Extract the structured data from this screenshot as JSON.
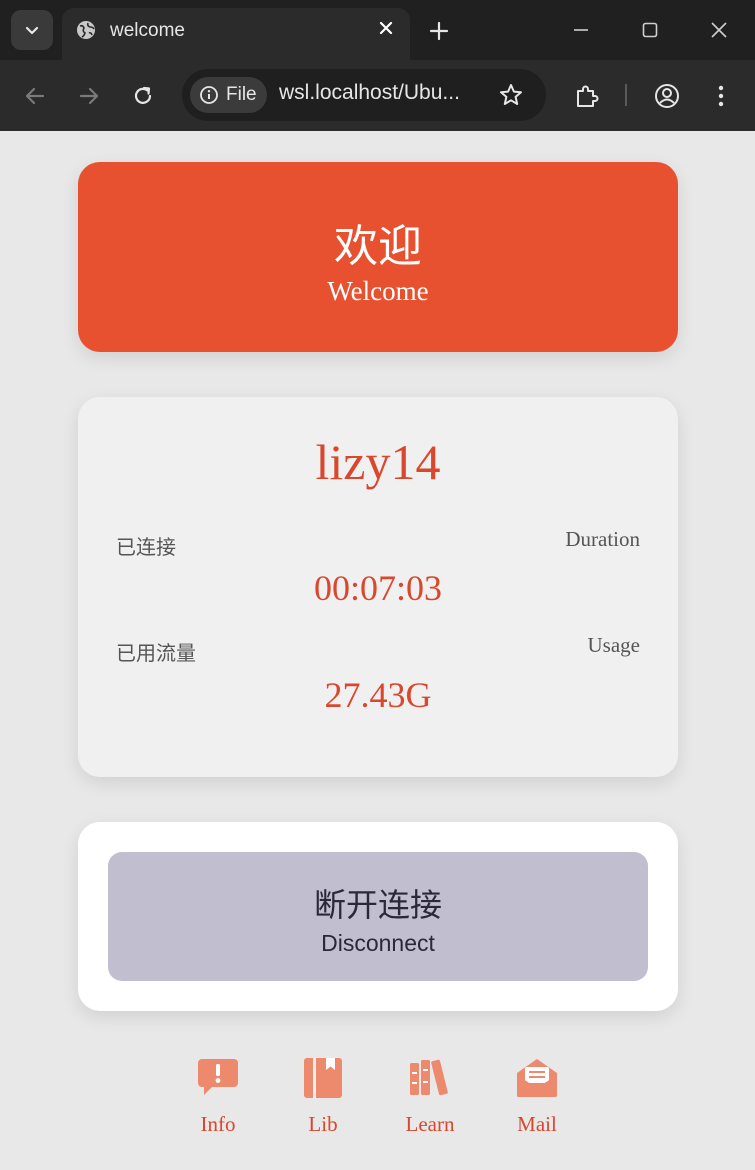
{
  "browser": {
    "tab_title": "welcome",
    "site_chip_label": "File",
    "url": "wsl.localhost/Ubu..."
  },
  "colors": {
    "accent": "#e8512f",
    "accent_text": "#d9472d",
    "card_bg": "#f1f0f0",
    "button_bg": "#c1bfcf",
    "icon_color": "#ed8a6e"
  },
  "welcome": {
    "title_zh": "欢迎",
    "title_en": "Welcome"
  },
  "status": {
    "username": "lizy14",
    "connected_label_zh": "已连接",
    "duration_label_en": "Duration",
    "duration_value": "00:07:03",
    "usage_label_zh": "已用流量",
    "usage_label_en": "Usage",
    "usage_value": "27.43G"
  },
  "action": {
    "disconnect_zh": "断开连接",
    "disconnect_en": "Disconnect"
  },
  "bottom_nav": [
    {
      "label": "Info",
      "icon": "info-comment-icon"
    },
    {
      "label": "Lib",
      "icon": "library-book-icon"
    },
    {
      "label": "Learn",
      "icon": "books-icon"
    },
    {
      "label": "Mail",
      "icon": "mail-icon"
    }
  ]
}
